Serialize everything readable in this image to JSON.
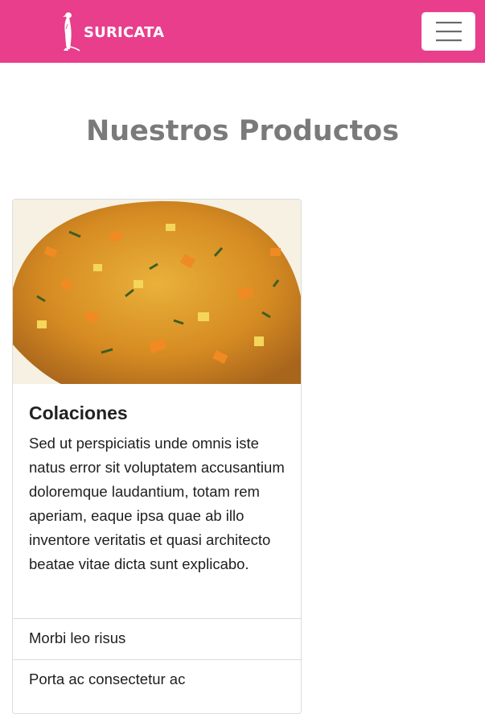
{
  "navbar": {
    "brand_text": "SURICATA",
    "toggler_icon": "hamburger-menu-icon",
    "background_color": "#e83e8c"
  },
  "section": {
    "title": "Nuestros Productos"
  },
  "card": {
    "image_alt": "food-image",
    "title": "Colaciones",
    "text": "Sed ut perspiciatis unde omnis iste natus error sit voluptatem accusantium doloremque laudantium, totam rem aperiam, eaque ipsa quae ab illo inventore veritatis et quasi architecto beatae vitae dicta sunt explicabo.",
    "list_items": [
      "Morbi leo risus",
      "Porta ac consectetur ac"
    ]
  }
}
